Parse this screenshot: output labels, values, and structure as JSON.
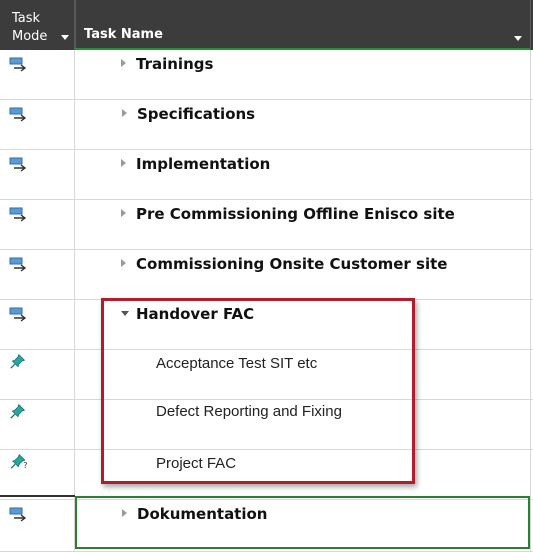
{
  "header": {
    "task_mode_line1": "Task",
    "task_mode_line2": "Mode",
    "task_name": "Task Name"
  },
  "rows": [
    {
      "name": "Trainings",
      "type": "summary",
      "mode_icon": "auto-schedule-icon"
    },
    {
      "name": "Specifications",
      "type": "summary",
      "mode_icon": "auto-schedule-icon"
    },
    {
      "name": "Implementation",
      "type": "summary",
      "mode_icon": "auto-schedule-icon"
    },
    {
      "name": "Pre Commissioning Offline  Enisco site",
      "type": "summary",
      "mode_icon": "auto-schedule-icon"
    },
    {
      "name": "Commissioning Onsite  Customer site",
      "type": "summary",
      "mode_icon": "auto-schedule-icon"
    },
    {
      "name": "Handover FAC",
      "type": "summary-expanded",
      "mode_icon": "auto-schedule-icon"
    },
    {
      "name": "Acceptance Test   SIT etc",
      "type": "subtask",
      "mode_icon": "pin-icon"
    },
    {
      "name": "Defect Reporting and Fixing",
      "type": "subtask",
      "mode_icon": "pin-icon"
    },
    {
      "name": "Project FAC",
      "type": "subtask",
      "mode_icon": "pin-question-icon"
    },
    {
      "name": "Dokumentation",
      "type": "summary",
      "mode_icon": "auto-schedule-icon"
    }
  ],
  "colors": {
    "header_bg": "#3c3c3c",
    "highlight_red": "#b01e2a",
    "highlight_green": "#2e7d32"
  }
}
